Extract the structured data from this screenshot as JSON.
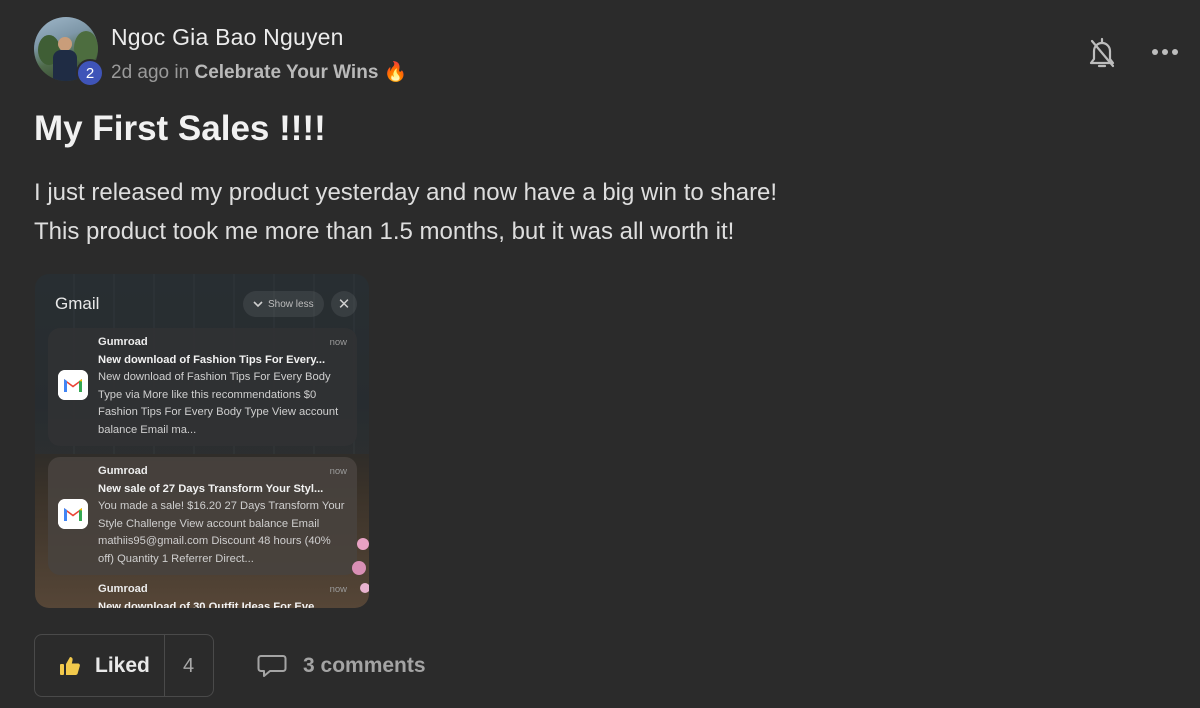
{
  "post": {
    "author": "Ngoc Gia Bao Nguyen",
    "level_badge": "2",
    "time_ago": "2d ago",
    "in_word": "in",
    "category": "Celebrate Your Wins",
    "category_emoji": "🔥",
    "title": "My First Sales !!!!",
    "body_lines": [
      "I just released my product yesterday and now have a big win to share!",
      "This product took me more than 1.5 months, but it was all worth it!"
    ],
    "actions": {
      "bell_icon": "bell-off-icon",
      "more_icon": "more-horizontal-icon"
    }
  },
  "attachment": {
    "app_name": "Gmail",
    "show_less_label": "Show less",
    "close_icon": "close-icon",
    "notifications": [
      {
        "sender": "Gumroad",
        "time": "now",
        "subject": "New download of Fashion Tips For Every...",
        "body": "New download of Fashion Tips For Every Body Type via More like this recommendations $0 Fashion Tips For Every Body Type View account balance Email ma..."
      },
      {
        "sender": "Gumroad",
        "time": "now",
        "subject": "New sale of 27 Days Transform Your Styl...",
        "body": "You made a sale! $16.20 27 Days Transform Your Style Challenge View account balance Email mathiis95@gmail.com Discount 48 hours (40% off) Quantity 1 Referrer Direct..."
      },
      {
        "sender": "Gumroad",
        "time": "now",
        "subject": "New download of 30 Outfit Ideas For Eve...",
        "body": ""
      }
    ]
  },
  "footer": {
    "liked_label": "Liked",
    "like_count": "4",
    "comments_label": "3 comments",
    "thumb_icon": "thumbs-up-icon",
    "comment_icon": "comment-icon"
  },
  "colors": {
    "background": "#2b2b2b",
    "badge": "#3f54b8",
    "liked_thumb": "#f2c94c"
  }
}
